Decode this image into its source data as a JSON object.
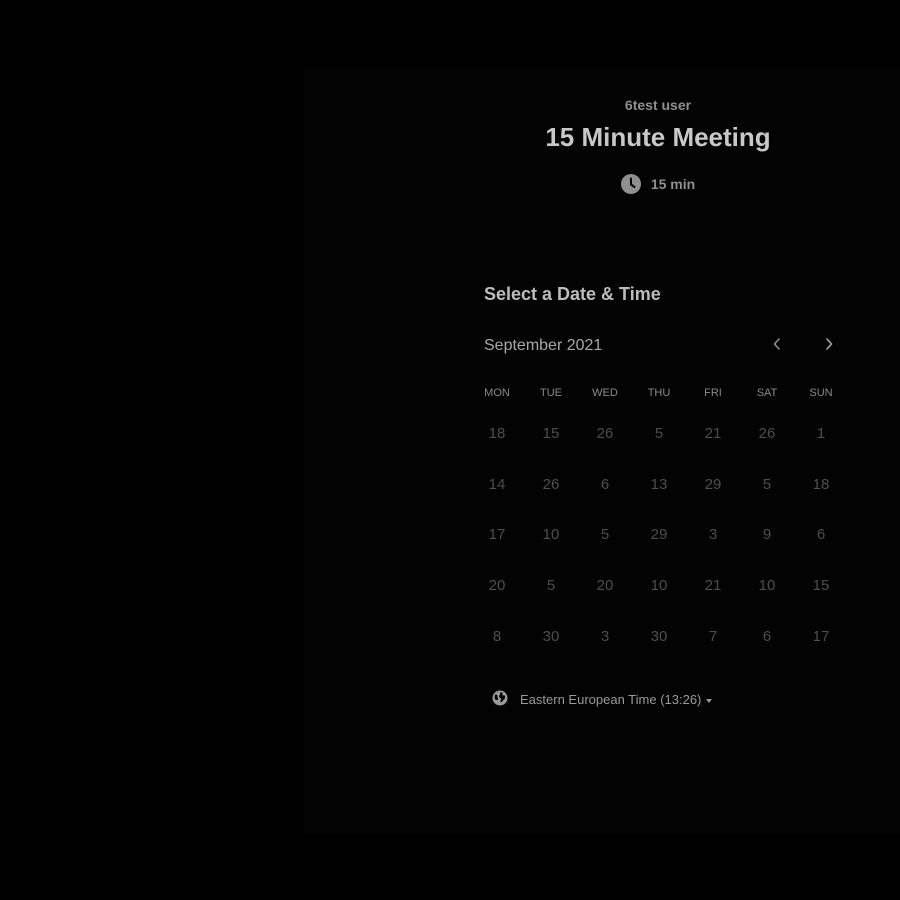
{
  "host": {
    "name": "6test user"
  },
  "event": {
    "title": "15 Minute Meeting",
    "duration": "15 min",
    "duration_icon": "clock-icon"
  },
  "scheduler": {
    "title": "Select a Date & Time",
    "month": "September 2021",
    "prev_icon": "chevron-left-icon",
    "next_icon": "chevron-right-icon",
    "weekdays": [
      "MON",
      "TUE",
      "WED",
      "THU",
      "FRI",
      "SAT",
      "SUN"
    ],
    "weeks": [
      [
        "18",
        "15",
        "26",
        "5",
        "21",
        "26",
        "1"
      ],
      [
        "14",
        "26",
        "6",
        "13",
        "29",
        "5",
        "18"
      ],
      [
        "17",
        "10",
        "5",
        "29",
        "3",
        "9",
        "6"
      ],
      [
        "20",
        "5",
        "20",
        "10",
        "21",
        "10",
        "15"
      ],
      [
        "8",
        "30",
        "3",
        "30",
        "7",
        "6",
        "17"
      ]
    ]
  },
  "timezone": {
    "label": "Eastern European Time (13:26)",
    "icon": "globe-icon",
    "caret_icon": "caret-down-icon"
  },
  "colors": {
    "background": "#000000",
    "title_text": "#c8c8c8",
    "muted_text": "#8f8f8f",
    "day_text": "#4e4e4e"
  }
}
